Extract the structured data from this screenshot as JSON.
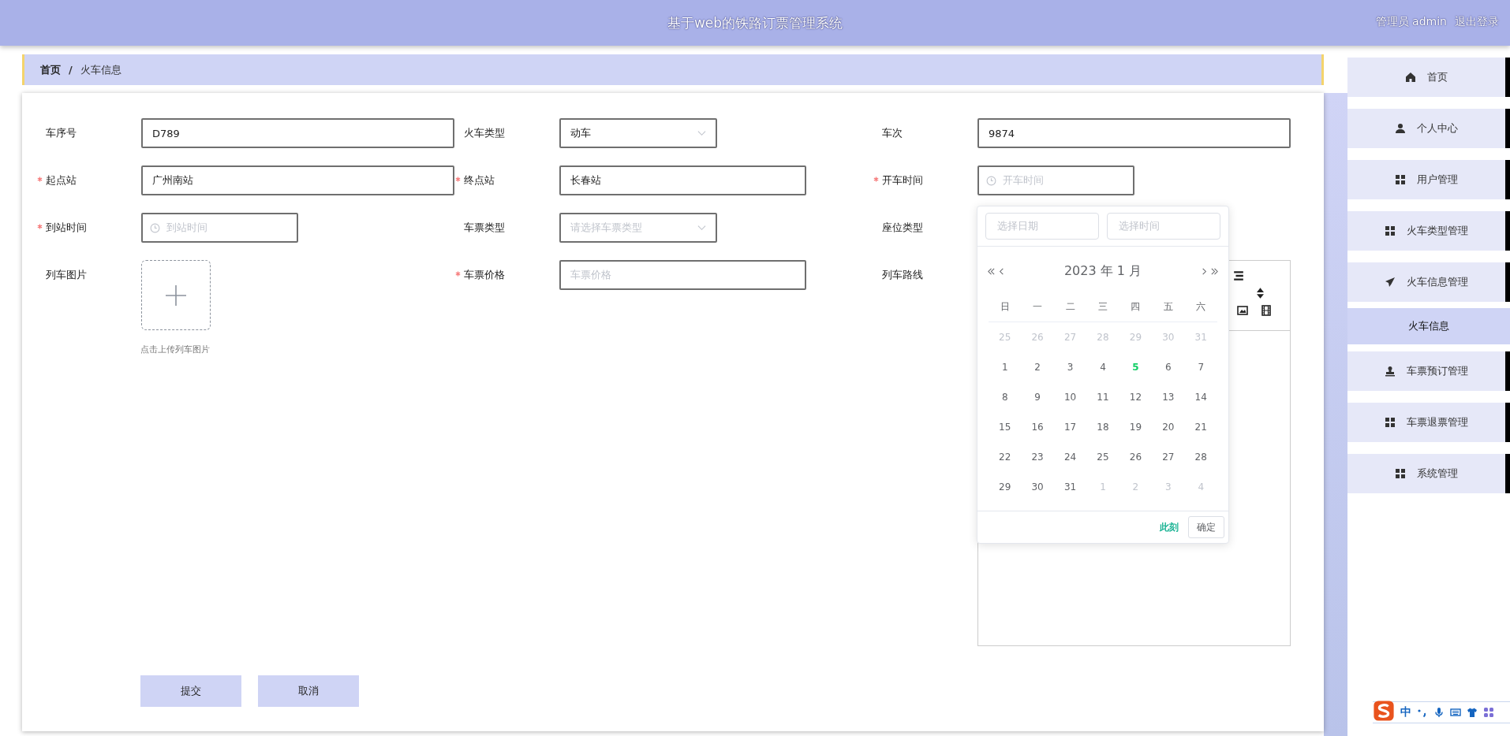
{
  "header": {
    "title": "基于web的铁路订票管理系统",
    "user": "管理员 admin",
    "logout": "退出登录"
  },
  "breadcrumb": {
    "separator": "/",
    "items": [
      {
        "label": "首页",
        "current": false
      },
      {
        "label": "火车信息",
        "current": true
      }
    ]
  },
  "form": {
    "rows": [
      [
        {
          "label": "车序号",
          "required": false,
          "kind": "text",
          "value": "D789"
        },
        {
          "label": "火车类型",
          "required": false,
          "kind": "select",
          "value": "动车"
        },
        {
          "label": "车次",
          "required": false,
          "kind": "text",
          "value": "9874"
        }
      ],
      [
        {
          "label": "起点站",
          "required": true,
          "kind": "text",
          "value": "广州南站"
        },
        {
          "label": "终点站",
          "required": true,
          "kind": "text-short",
          "value": "长春站"
        },
        {
          "label": "开车时间",
          "required": true,
          "kind": "datetime",
          "placeholder": "开车时间"
        }
      ],
      [
        {
          "label": "到站时间",
          "required": true,
          "kind": "datetime",
          "placeholder": "到站时间"
        },
        {
          "label": "车票类型",
          "required": false,
          "kind": "select",
          "placeholder": "请选择车票类型"
        },
        {
          "label": "座位类型",
          "required": false,
          "kind": "covered"
        }
      ],
      [
        {
          "label": "列车图片",
          "required": false,
          "kind": "upload",
          "caption": "点击上传列车图片"
        },
        {
          "label": "车票价格",
          "required": true,
          "kind": "text-short",
          "placeholder": "车票价格"
        },
        {
          "label": "列车路线",
          "required": false,
          "kind": "editor"
        }
      ]
    ],
    "buttons": [
      {
        "label": "提交"
      },
      {
        "label": "取消"
      }
    ]
  },
  "date_picker": {
    "date_placeholder": "选择日期",
    "time_placeholder": "选择时间",
    "title": "2023 年 1 月",
    "weekdays": [
      "日",
      "一",
      "二",
      "三",
      "四",
      "五",
      "六"
    ],
    "weeks": [
      [
        {
          "day": "25",
          "other_month": true,
          "today": false
        },
        {
          "day": "26",
          "other_month": true,
          "today": false
        },
        {
          "day": "27",
          "other_month": true,
          "today": false
        },
        {
          "day": "28",
          "other_month": true,
          "today": false
        },
        {
          "day": "29",
          "other_month": true,
          "today": false
        },
        {
          "day": "30",
          "other_month": true,
          "today": false
        },
        {
          "day": "31",
          "other_month": true,
          "today": false
        }
      ],
      [
        {
          "day": "1",
          "other_month": false,
          "today": false
        },
        {
          "day": "2",
          "other_month": false,
          "today": false
        },
        {
          "day": "3",
          "other_month": false,
          "today": false
        },
        {
          "day": "4",
          "other_month": false,
          "today": false
        },
        {
          "day": "5",
          "other_month": false,
          "today": true
        },
        {
          "day": "6",
          "other_month": false,
          "today": false
        },
        {
          "day": "7",
          "other_month": false,
          "today": false
        }
      ],
      [
        {
          "day": "8",
          "other_month": false,
          "today": false
        },
        {
          "day": "9",
          "other_month": false,
          "today": false
        },
        {
          "day": "10",
          "other_month": false,
          "today": false
        },
        {
          "day": "11",
          "other_month": false,
          "today": false
        },
        {
          "day": "12",
          "other_month": false,
          "today": false
        },
        {
          "day": "13",
          "other_month": false,
          "today": false
        },
        {
          "day": "14",
          "other_month": false,
          "today": false
        }
      ],
      [
        {
          "day": "15",
          "other_month": false,
          "today": false
        },
        {
          "day": "16",
          "other_month": false,
          "today": false
        },
        {
          "day": "17",
          "other_month": false,
          "today": false
        },
        {
          "day": "18",
          "other_month": false,
          "today": false
        },
        {
          "day": "19",
          "other_month": false,
          "today": false
        },
        {
          "day": "20",
          "other_month": false,
          "today": false
        },
        {
          "day": "21",
          "other_month": false,
          "today": false
        }
      ],
      [
        {
          "day": "22",
          "other_month": false,
          "today": false
        },
        {
          "day": "23",
          "other_month": false,
          "today": false
        },
        {
          "day": "24",
          "other_month": false,
          "today": false
        },
        {
          "day": "25",
          "other_month": false,
          "today": false
        },
        {
          "day": "26",
          "other_month": false,
          "today": false
        },
        {
          "day": "27",
          "other_month": false,
          "today": false
        },
        {
          "day": "28",
          "other_month": false,
          "today": false
        }
      ],
      [
        {
          "day": "29",
          "other_month": false,
          "today": false
        },
        {
          "day": "30",
          "other_month": false,
          "today": false
        },
        {
          "day": "31",
          "other_month": false,
          "today": false
        },
        {
          "day": "1",
          "other_month": true,
          "today": false
        },
        {
          "day": "2",
          "other_month": true,
          "today": false
        },
        {
          "day": "3",
          "other_month": true,
          "today": false
        },
        {
          "day": "4",
          "other_month": true,
          "today": false
        }
      ]
    ],
    "now": "此刻",
    "confirm": "确定"
  },
  "sidebar": [
    {
      "label": "首页",
      "kind": "home",
      "selected": false
    },
    {
      "label": "个人中心",
      "kind": "user",
      "selected": false
    },
    {
      "label": "用户管理",
      "kind": "grid",
      "selected": false
    },
    {
      "label": "火车类型管理",
      "kind": "grid",
      "selected": false
    },
    {
      "label": "火车信息管理",
      "kind": "plane",
      "selected": false
    },
    {
      "label": "火车信息",
      "kind": "sub",
      "selected": true
    },
    {
      "label": "车票预订管理",
      "kind": "stamp",
      "selected": false
    },
    {
      "label": "车票退票管理",
      "kind": "grid",
      "selected": false
    },
    {
      "label": "系统管理",
      "kind": "grid",
      "selected": false
    }
  ],
  "ime": {
    "mode": "中"
  }
}
